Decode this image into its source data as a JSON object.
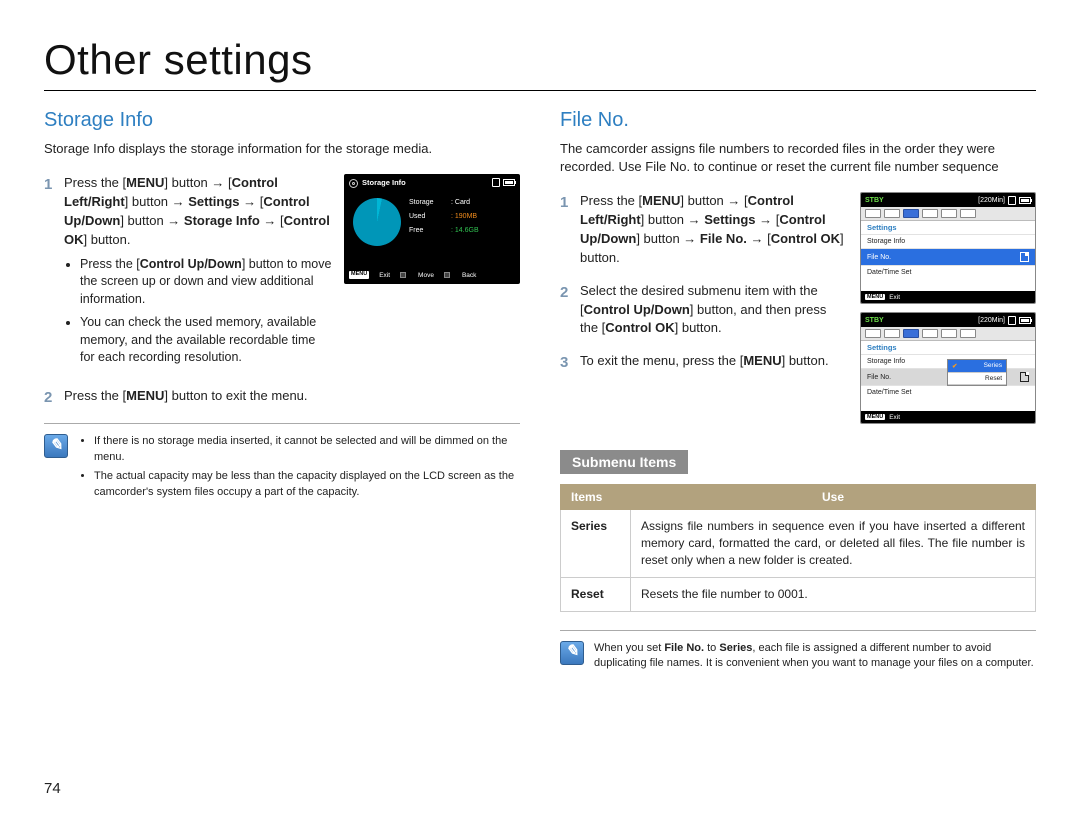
{
  "page_title": "Other settings",
  "page_number": "74",
  "left": {
    "heading": "Storage Info",
    "intro": "Storage Info displays the storage information for the storage media.",
    "steps": [
      {
        "num": "1",
        "line_a": "Press the [",
        "menu": "MENU",
        "line_b": "] button → [",
        "ctrl_lr": "Control Left/Right",
        "line_c": "] button → ",
        "settings": "Settings",
        "arrow1": " → [",
        "ctrl_ud": "Control Up/Down",
        "line_d": "] button → ",
        "storage_info": "Storage Info",
        "arrow2": " → [",
        "ctrl_ok": "Control OK",
        "line_e": "] button.",
        "bullets": [
          {
            "b1a": "Press the [",
            "b1bold": "Control Up/Down",
            "b1b": "] button to move the screen up or down and view additional information."
          },
          {
            "text": "You can check the used memory, available memory, and the available recordable time for each recording resolution."
          }
        ]
      },
      {
        "num": "2",
        "line_a": "Press the [",
        "menu": "MENU",
        "line_b": "] button to exit the menu."
      }
    ],
    "lcd": {
      "title": "Storage Info",
      "rows": {
        "storage_k": "Storage",
        "storage_v": ": Card",
        "used_k": "Used",
        "used_v": ": 190MB",
        "free_k": "Free",
        "free_v": ": 14.6GB"
      },
      "footer": {
        "menu": "MENU",
        "exit": "Exit",
        "move": "Move",
        "back": "Back"
      }
    },
    "notes": [
      "If there is no storage media inserted, it cannot be selected and will be dimmed on the menu.",
      "The actual capacity may be less than the capacity displayed on the LCD screen as the camcorder's system files occupy a part of the capacity."
    ]
  },
  "right": {
    "heading": "File No.",
    "intro": "The camcorder assigns file numbers to recorded files in the order they were recorded. Use File No. to continue or reset the current file number sequence",
    "steps": [
      {
        "num": "1",
        "a": "Press the [",
        "menu": "MENU",
        "b": "] button → [",
        "ctrl_lr": "Control Left/Right",
        "c": "] button → ",
        "settings": "Settings",
        "d": " → [",
        "ctrl_ud": "Control Up/Down",
        "e": "] button → ",
        "fileno": "File No.",
        "f": " → [",
        "ctrl_ok": "Control OK",
        "g": "] button."
      },
      {
        "num": "2",
        "a": "Select the desired submenu item with the [",
        "ctrl_ud": "Control Up/Down",
        "b": "] button, and then press the [",
        "ctrl_ok": "Control OK",
        "c": "] button."
      },
      {
        "num": "3",
        "a": "To exit the menu, press the [",
        "menu": "MENU",
        "b": "] button."
      }
    ],
    "lcd1": {
      "stby": "STBY",
      "time": "[220Min]",
      "hdr": "Settings",
      "opt1": "Storage Info",
      "opt2": "File No.",
      "opt3": "Date/Time Set",
      "footer_menu": "MENU",
      "footer_exit": "Exit"
    },
    "lcd2": {
      "stby": "STBY",
      "time": "[220Min]",
      "hdr": "Settings",
      "opt1": "Storage Info",
      "opt2": "File No.",
      "opt3": "Date/Time Set",
      "sub_series": "Series",
      "sub_reset": "Reset",
      "footer_menu": "MENU",
      "footer_exit": "Exit"
    },
    "submenu_heading": "Submenu Items",
    "table": {
      "h_items": "Items",
      "h_use": "Use",
      "row1_k": "Series",
      "row1_v": "Assigns file numbers in sequence even if you have inserted a different memory card, formatted the card, or deleted all files. The file number is reset only when a new folder is created.",
      "row2_k": "Reset",
      "row2_v": "Resets the file number to 0001."
    },
    "note_a": "When you set ",
    "note_bold1": "File No.",
    "note_b": " to ",
    "note_bold2": "Series",
    "note_c": ", each file is assigned a different number to avoid duplicating file names. It is convenient when you want to manage your files on a computer."
  }
}
